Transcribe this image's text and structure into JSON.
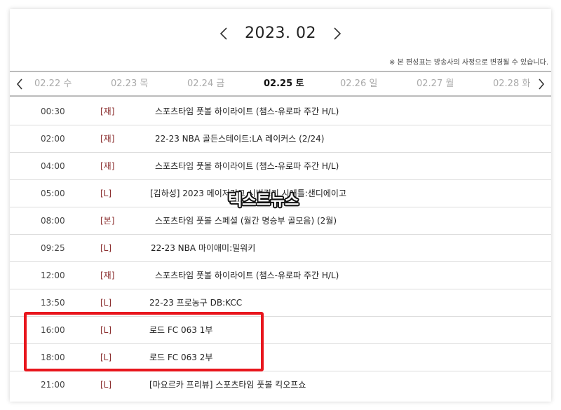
{
  "header": {
    "month_title": "2023. 02",
    "notice": "※ 본 편성표는 방송사의 사정으로 변경될 수 있습니다."
  },
  "date_tabs": [
    {
      "label": "02.22 수",
      "active": false
    },
    {
      "label": "02.23 목",
      "active": false
    },
    {
      "label": "02.24 금",
      "active": false
    },
    {
      "label": "02.25 토",
      "active": true
    },
    {
      "label": "02.26 일",
      "active": false
    },
    {
      "label": "02.27 월",
      "active": false
    },
    {
      "label": "02.28 화",
      "active": false
    }
  ],
  "schedule": [
    {
      "time": "00:30",
      "tag": "[재]",
      "title": "스포츠타임 풋볼 하이라이트 (챔스-유로파 주간 H/L)"
    },
    {
      "time": "02:00",
      "tag": "[재]",
      "title": "22-23 NBA 골든스테이트:LA 레이커스 (2/24)"
    },
    {
      "time": "04:00",
      "tag": "[재]",
      "title": "스포츠타임 풋볼 하이라이트 (챔스-유로파 주간 H/L)"
    },
    {
      "time": "05:00",
      "tag": "[L]",
      "title": "[김하성] 2023 메이저리그 시범경기 시애틀:샌디에이고"
    },
    {
      "time": "08:00",
      "tag": "[본]",
      "title": "스포츠타임 풋볼 스페셜 (월간 명승부 골모음) (2월)"
    },
    {
      "time": "09:25",
      "tag": "[L]",
      "title": "22-23 NBA 마이애미:밀워키"
    },
    {
      "time": "12:00",
      "tag": "[재]",
      "title": "스포츠타임 풋볼 하이라이트 (챔스-유로파 주간 H/L)"
    },
    {
      "time": "13:50",
      "tag": "[L]",
      "title": "22-23 프로농구 DB:KCC"
    },
    {
      "time": "16:00",
      "tag": "[L]",
      "title": "로드 FC 063 1부"
    },
    {
      "time": "18:00",
      "tag": "[L]",
      "title": "로드 FC 063 2부"
    },
    {
      "time": "21:00",
      "tag": "[L]",
      "title": "[마요르카 프리뷰] 스포츠타임 풋볼 킥오프쇼"
    }
  ],
  "watermark": "텍스트뉴스",
  "colors": {
    "tag": "#8b2f2f",
    "highlight": "#e8161d",
    "active_tab": "#111111",
    "inactive_tab": "#aaaaaa"
  }
}
